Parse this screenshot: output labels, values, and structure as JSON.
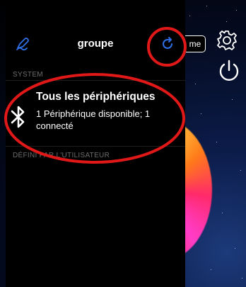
{
  "header": {
    "title": "groupe",
    "edit_icon": "pen-icon",
    "refresh_icon": "refresh-icon"
  },
  "sections": {
    "system_label": "SYSTEM",
    "user_label": "DÉFINI PAR L'UTILISATEUR"
  },
  "device": {
    "icon": "bluetooth-icon",
    "title": "Tous les périphériques",
    "status": "1 Périphérique disponible; 1 connecté"
  },
  "right_bar": {
    "button_label": "me",
    "settings_icon": "gear-icon",
    "power_icon": "power-icon"
  },
  "colors": {
    "accent": "#2f6fe6",
    "annotation": "#e01818",
    "section_text": "#6d6d6d"
  }
}
